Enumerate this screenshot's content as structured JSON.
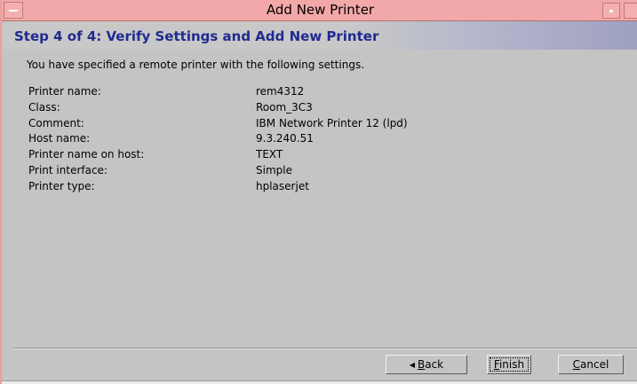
{
  "window": {
    "title": "Add New Printer"
  },
  "header": {
    "step_title": "Step 4 of 4:  Verify Settings and Add New Printer"
  },
  "intro": "You have specified a remote printer with the following settings.",
  "settings": [
    {
      "label": "Printer name:",
      "value": "rem4312"
    },
    {
      "label": "Class:",
      "value": "Room_3C3"
    },
    {
      "label": "Comment:",
      "value": "IBM Network Printer 12 (lpd)"
    },
    {
      "label": "Host name:",
      "value": "9.3.240.51"
    },
    {
      "label": "Printer name on host:",
      "value": "TEXT"
    },
    {
      "label": "Print interface:",
      "value": "Simple"
    },
    {
      "label": "Printer type:",
      "value": "hplaserjet"
    }
  ],
  "buttons": {
    "back": {
      "mnemonic": "B",
      "rest": "ack"
    },
    "finish": {
      "mnemonic": "F",
      "rest": "inish"
    },
    "cancel": {
      "mnemonic": "C",
      "rest": "ancel"
    }
  },
  "colors": {
    "titlebar": "#f2a8a8",
    "step_title": "#1f2b8f",
    "body": "#c4c4c4"
  }
}
